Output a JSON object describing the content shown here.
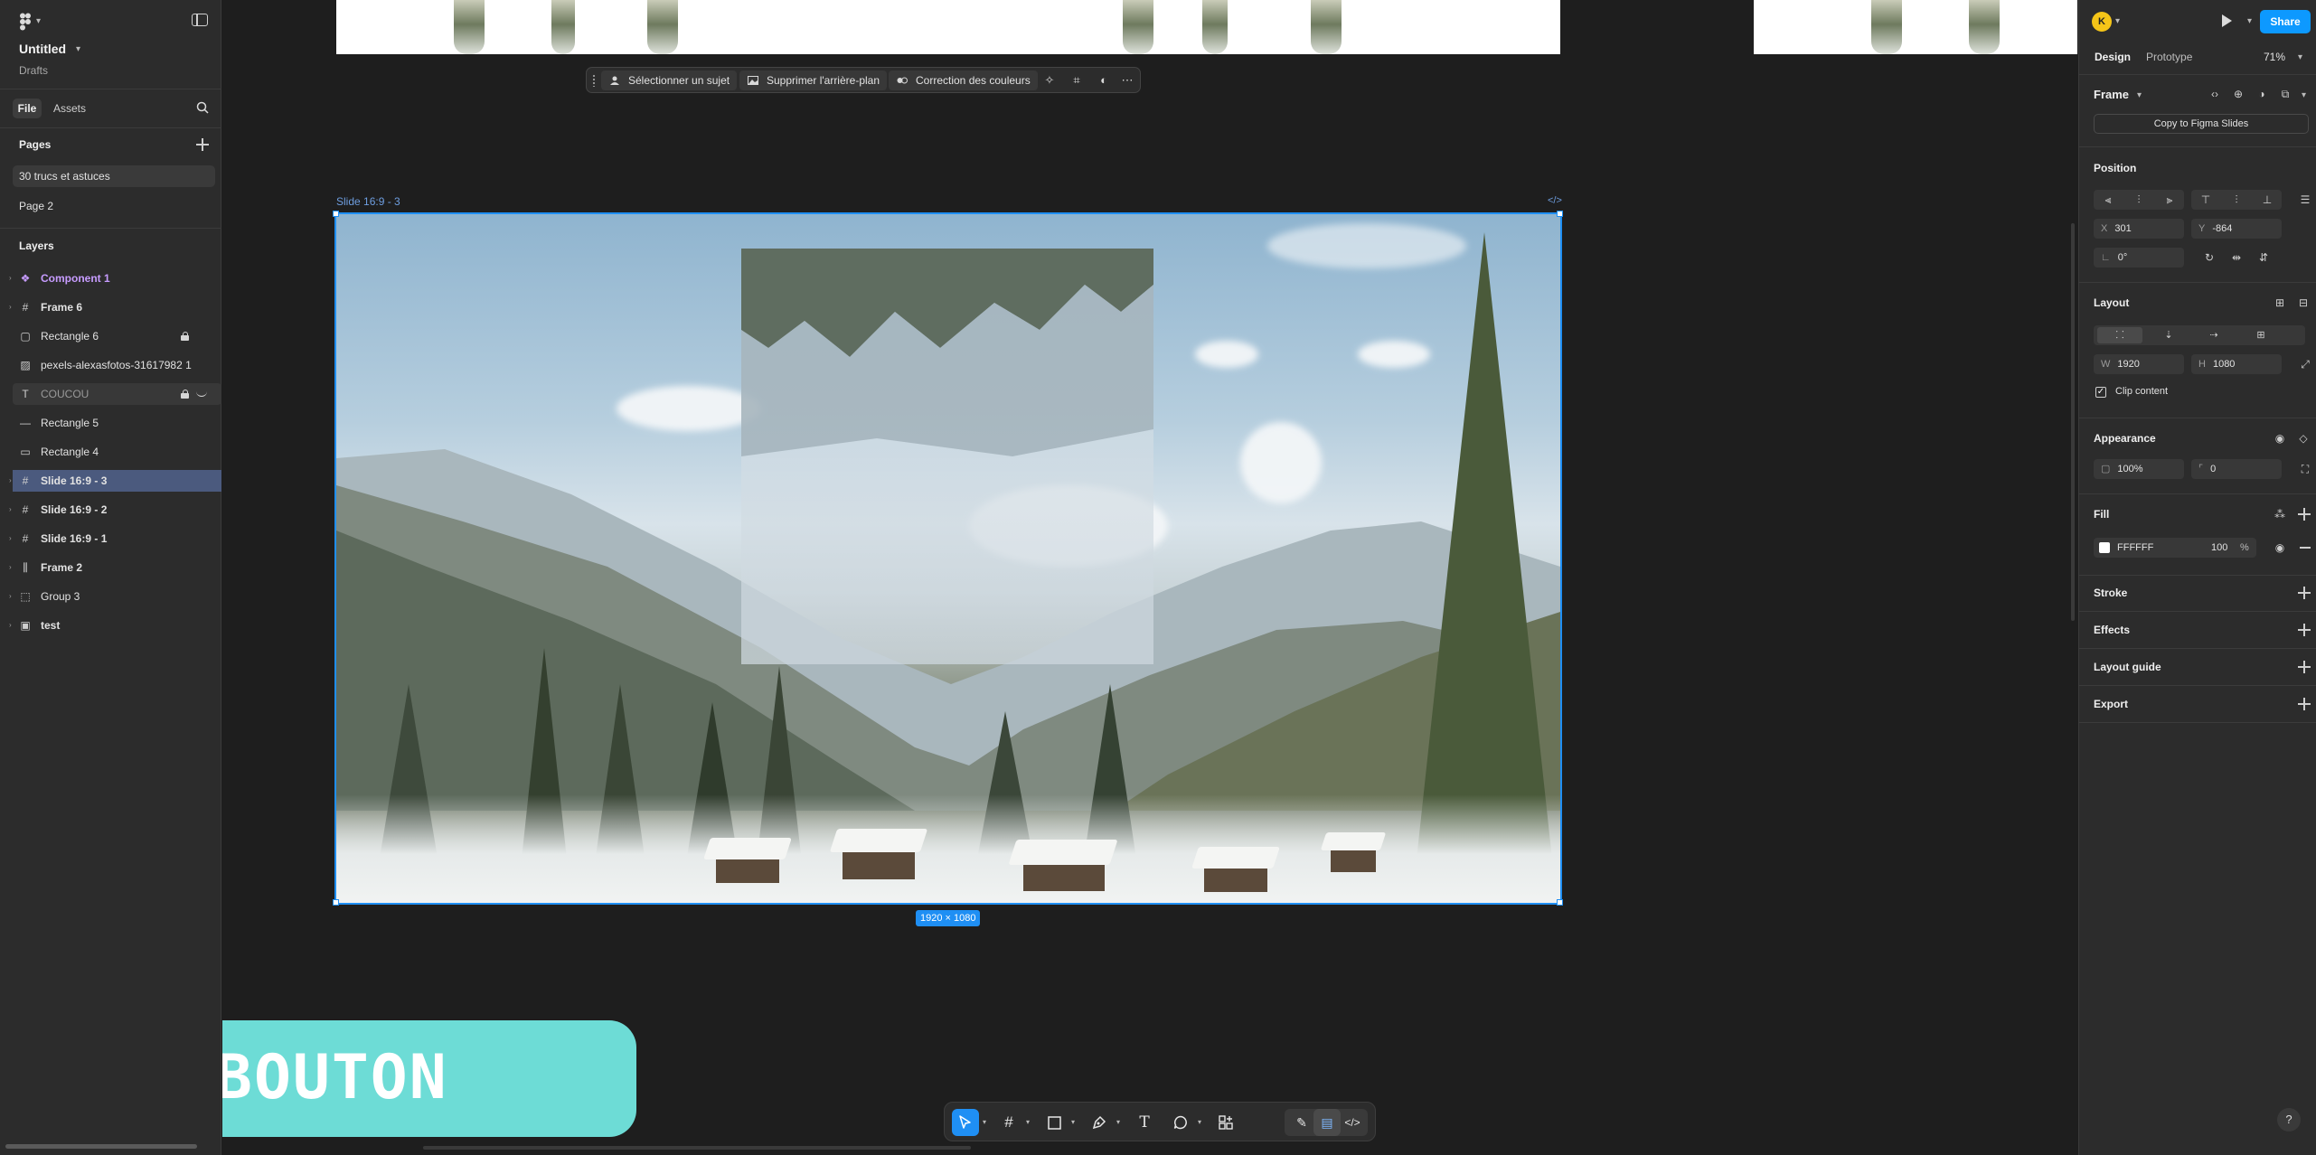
{
  "file": {
    "title": "Untitled",
    "location": "Drafts"
  },
  "left_tabs": {
    "file": "File",
    "assets": "Assets"
  },
  "pages": {
    "heading": "Pages",
    "items": [
      {
        "label": "30 trucs et astuces",
        "active": true
      },
      {
        "label": "Page 2",
        "active": false
      }
    ]
  },
  "layers": {
    "heading": "Layers",
    "items": [
      {
        "label": "Component 1",
        "icon": "component-icon"
      },
      {
        "label": "Frame 6",
        "icon": "frame-icon"
      },
      {
        "label": "Rectangle 6",
        "icon": "rectangle-icon",
        "locked": true
      },
      {
        "label": "pexels-alexasfotos-31617982 1",
        "icon": "image-icon"
      },
      {
        "label": "COUCOU",
        "icon": "text-icon",
        "locked": true,
        "hidden": true
      },
      {
        "label": "Rectangle 5",
        "icon": "line-icon"
      },
      {
        "label": "Rectangle 4",
        "icon": "rectangle-icon"
      },
      {
        "label": "Slide 16:9 - 3",
        "icon": "frame-icon",
        "selected": true
      },
      {
        "label": "Slide 16:9 - 2",
        "icon": "frame-icon"
      },
      {
        "label": "Slide 16:9 - 1",
        "icon": "frame-icon"
      },
      {
        "label": "Frame 2",
        "icon": "autolayout-frame-icon"
      },
      {
        "label": "Group 3",
        "icon": "group-icon"
      },
      {
        "label": "test",
        "icon": "section-icon"
      }
    ]
  },
  "context_toolbar": {
    "select_subject": "Sélectionner un sujet",
    "remove_background": "Supprimer l'arrière-plan",
    "color_correction": "Correction des couleurs"
  },
  "canvas": {
    "frame_label": "Slide 16:9 - 3",
    "code_tag": "</>",
    "dimensions": "1920 × 1080",
    "card_text": "BOUTON",
    "card_color": "#6ddcd6",
    "selection_color": "#1f8ff4"
  },
  "header_right": {
    "avatar_initial": "K",
    "share": "Share",
    "tabs": {
      "design": "Design",
      "prototype": "Prototype"
    },
    "zoom": "71%"
  },
  "design_panel": {
    "frame_type": "Frame",
    "copy_button": "Copy to Figma Slides",
    "position": {
      "heading": "Position",
      "x_label": "X",
      "x": "301",
      "y_label": "Y",
      "y": "-864",
      "rotation": "0°"
    },
    "layout": {
      "heading": "Layout",
      "w_label": "W",
      "w": "1920",
      "h_label": "H",
      "h": "1080",
      "clip_content": "Clip content"
    },
    "appearance": {
      "heading": "Appearance",
      "opacity": "100%",
      "radius": "0"
    },
    "fill": {
      "heading": "Fill",
      "hex": "FFFFFF",
      "opacity": "100",
      "percent": "%"
    },
    "stroke": "Stroke",
    "effects": "Effects",
    "layout_guide": "Layout guide",
    "export": "Export"
  },
  "help": "?"
}
